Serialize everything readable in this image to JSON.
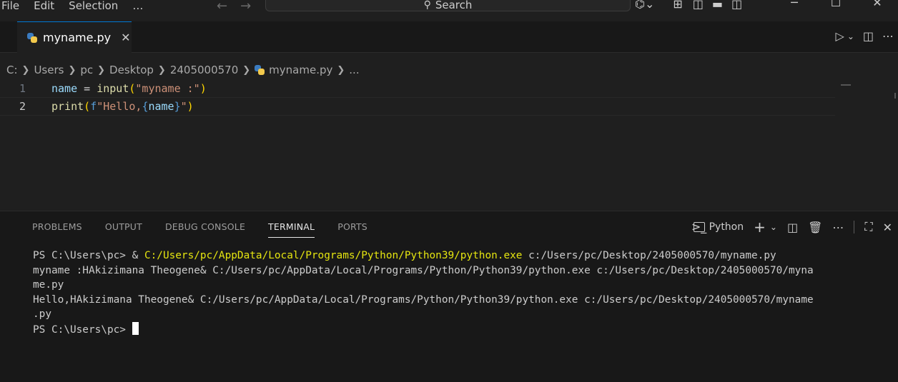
{
  "menu": {
    "items": [
      "File",
      "Edit",
      "Selection",
      "…"
    ]
  },
  "search": {
    "placeholder": "Search"
  },
  "tab": {
    "label": "myname.py",
    "close": "✕"
  },
  "breadcrumb": [
    "C:",
    "Users",
    "pc",
    "Desktop",
    "2405000570",
    "myname.py",
    "..."
  ],
  "editor": {
    "lines": [
      {
        "number": "1"
      },
      {
        "number": "2"
      }
    ]
  },
  "panel": {
    "tabs": [
      "PROBLEMS",
      "OUTPUT",
      "DEBUG CONSOLE",
      "TERMINAL",
      "PORTS"
    ],
    "active_tab": "TERMINAL",
    "terminal_name": "Python"
  },
  "terminal": {
    "line1_prompt": "PS C:\\Users\\pc> ",
    "line1_amp": "& ",
    "line1_exe": "C:/Users/pc/AppData/Local/Programs/Python/Python39/python.exe",
    "line1_arg": " c:/Users/pc/Desktop/2405000570/myname.py",
    "line2": "myname :HAkizimana Theogene& C:/Users/pc/AppData/Local/Programs/Python/Python39/python.exe c:/Users/pc/Desktop/2405000570/myna",
    "line3": "me.py",
    "line4": "Hello,HAkizimana Theogene& C:/Users/pc/AppData/Local/Programs/Python/Python39/python.exe c:/Users/pc/Desktop/2405000570/myname",
    "line5": ".py",
    "line6_prompt": "PS C:\\Users\\pc> "
  },
  "colors": {
    "accent": "#0078d4",
    "editor_bg": "#1f1f1f",
    "panel_bg": "#181818",
    "terminal_yellow": "#e5e510"
  }
}
